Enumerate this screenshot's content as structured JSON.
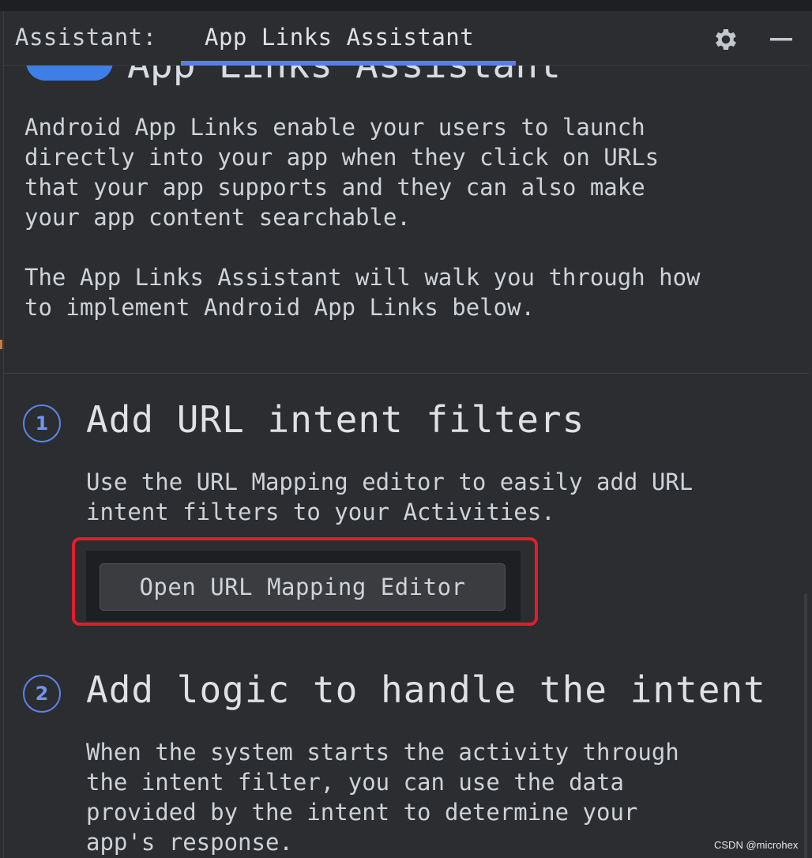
{
  "header": {
    "label": "Assistant:",
    "tab_label": "App Links Assistant",
    "gear_icon": "gear-icon",
    "minimize_icon": "minimize-icon"
  },
  "colors": {
    "background": "#2b2d30",
    "accent": "#5a7de8",
    "highlight_border": "#e01e2c",
    "button_bg": "#3a3c40"
  },
  "content": {
    "scrolled_title": "App Links Assistant",
    "intro": "Android App Links enable your users to launch\ndirectly into your app when they click on URLs\nthat your app supports and they can also make\nyour app content searchable.\n\nThe App Links Assistant will walk you through how\nto implement Android App Links below.",
    "steps": [
      {
        "number": "1",
        "title": "Add URL intent filters",
        "description": "Use the URL Mapping editor to easily add URL\nintent filters to your Activities.",
        "button_label": "Open URL Mapping Editor"
      },
      {
        "number": "2",
        "title": "Add logic to handle the intent",
        "description": "When the system starts the activity through\nthe intent filter, you can use the data\nprovided by the intent to determine your\napp's response."
      }
    ]
  },
  "watermark": "CSDN @microhex"
}
